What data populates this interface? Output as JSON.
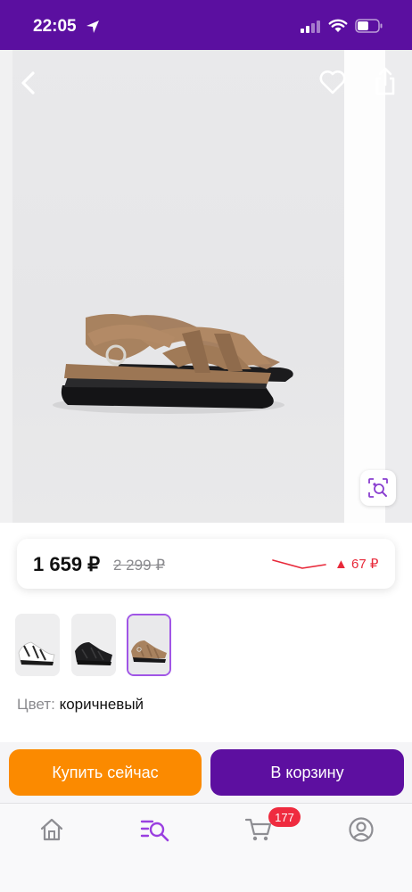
{
  "status_bar": {
    "time": "22:05"
  },
  "product": {
    "price": "1 659 ₽",
    "old_price": "2 299 ₽",
    "price_change": "▲ 67 ₽",
    "color_label": "Цвет:",
    "color_value": "коричневый",
    "thumbnails": [
      "white",
      "black",
      "brown"
    ],
    "selected_thumbnail": 2
  },
  "actions": {
    "buy_now": "Купить сейчас",
    "add_to_cart": "В корзину"
  },
  "tabbar": {
    "items": [
      "home-icon",
      "catalog-search-icon",
      "cart-icon",
      "profile-icon"
    ],
    "cart_count": "177",
    "active": "catalog-search-icon"
  },
  "colors": {
    "brand": "#5b0fa0",
    "buy_now": "#fb8a00",
    "badge": "#ef2b3f",
    "price_drop": "#e8293a"
  }
}
